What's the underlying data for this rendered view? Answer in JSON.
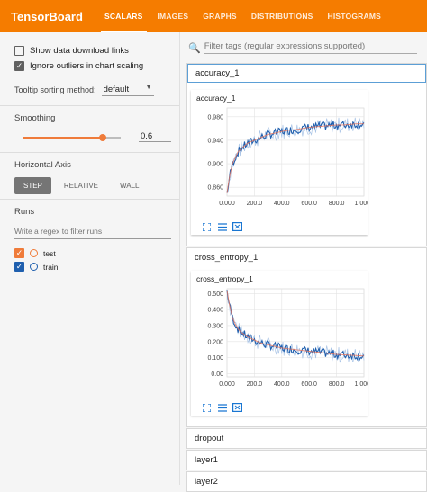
{
  "app": {
    "title": "TensorBoard"
  },
  "tabs": [
    "SCALARS",
    "IMAGES",
    "GRAPHS",
    "DISTRIBUTIONS",
    "HISTOGRAMS"
  ],
  "active_tab": "SCALARS",
  "sidebar": {
    "show_download": "Show data download links",
    "ignore_outliers": "Ignore outliers in chart scaling",
    "tooltip_label": "Tooltip sorting method:",
    "tooltip_value": "default",
    "smoothing_title": "Smoothing",
    "smoothing_value": "0.6",
    "smoothing_fraction": 0.6,
    "horizontal_axis_title": "Horizontal Axis",
    "axis_options": [
      "STEP",
      "RELATIVE",
      "WALL"
    ],
    "runs_title": "Runs",
    "regex_placeholder": "Write a regex to filter runs",
    "runs": [
      {
        "name": "test",
        "color": "#ef7b3a"
      },
      {
        "name": "train",
        "color": "#1f5fae"
      }
    ]
  },
  "main": {
    "filter_placeholder": "Filter tags (regular expressions supported)",
    "groups": [
      "accuracy_1",
      "cross_entropy_1",
      "dropout",
      "layer1",
      "layer2"
    ]
  },
  "chart_data": [
    {
      "type": "line",
      "title": "accuracy_1",
      "x_ticks": [
        "0.000",
        "200.0",
        "400.0",
        "600.0",
        "800.0",
        "1.000k"
      ],
      "y_ticks": [
        "0.860",
        "0.900",
        "0.940",
        "0.980"
      ],
      "xlim": [
        0,
        1000
      ],
      "ylim": [
        0.845,
        0.995
      ],
      "series": [
        {
          "color": "#1f5fae",
          "x": [
            0,
            20,
            40,
            60,
            80,
            100,
            150,
            200,
            250,
            300,
            350,
            400,
            450,
            500,
            550,
            600,
            650,
            700,
            750,
            800,
            850,
            900,
            950,
            1000
          ],
          "values": [
            0.85,
            0.88,
            0.9,
            0.91,
            0.92,
            0.925,
            0.935,
            0.94,
            0.945,
            0.95,
            0.952,
            0.955,
            0.957,
            0.958,
            0.96,
            0.962,
            0.963,
            0.964,
            0.965,
            0.966,
            0.966,
            0.967,
            0.968,
            0.968
          ]
        }
      ]
    },
    {
      "type": "line",
      "title": "cross_entropy_1",
      "x_ticks": [
        "0.000",
        "200.0",
        "400.0",
        "600.0",
        "800.0",
        "1.000k"
      ],
      "y_ticks": [
        "0.00",
        "0.100",
        "0.200",
        "0.300",
        "0.400",
        "0.500"
      ],
      "xlim": [
        0,
        1000
      ],
      "ylim": [
        -0.02,
        0.53
      ],
      "series": [
        {
          "color": "#1f5fae",
          "x": [
            0,
            20,
            40,
            60,
            80,
            100,
            150,
            200,
            250,
            300,
            350,
            400,
            450,
            500,
            550,
            600,
            650,
            700,
            750,
            800,
            850,
            900,
            950,
            1000
          ],
          "values": [
            0.52,
            0.42,
            0.35,
            0.31,
            0.28,
            0.26,
            0.23,
            0.21,
            0.19,
            0.18,
            0.17,
            0.16,
            0.155,
            0.15,
            0.145,
            0.14,
            0.135,
            0.13,
            0.125,
            0.12,
            0.118,
            0.115,
            0.113,
            0.11
          ]
        }
      ]
    }
  ]
}
